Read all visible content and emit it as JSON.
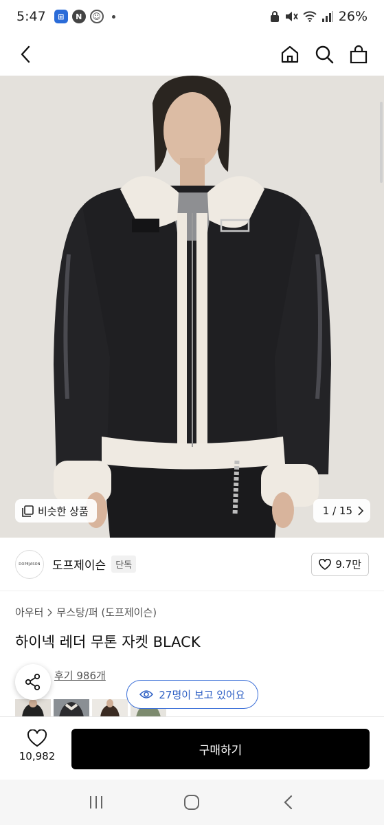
{
  "status_bar": {
    "time": "5:47",
    "battery": "26%"
  },
  "header": {
    "back_icon": "chevron-left-icon",
    "home_icon": "home-icon",
    "search_icon": "search-icon",
    "cart_icon": "shopping-bag-icon"
  },
  "gallery": {
    "similar_label": "비슷한 상품",
    "counter": "1 / 15"
  },
  "brand": {
    "logo_text": "DOPEJASON",
    "name": "도프제이슨",
    "badge": "단독",
    "likes": "9.7만"
  },
  "breadcrumb": {
    "category": "아우터",
    "subcategory": "무스탕/퍼 (도프제이슨)"
  },
  "product": {
    "title": "하이넥 레더 무톤 자켓 BLACK",
    "reviews": "후기 986개"
  },
  "viewers": {
    "text": "27명이 보고 있어요"
  },
  "bottom_bar": {
    "wish_count": "10,982",
    "buy_label": "구매하기"
  },
  "colors": {
    "accent_blue": "#3b6fd8",
    "buy_button": "#000000"
  }
}
